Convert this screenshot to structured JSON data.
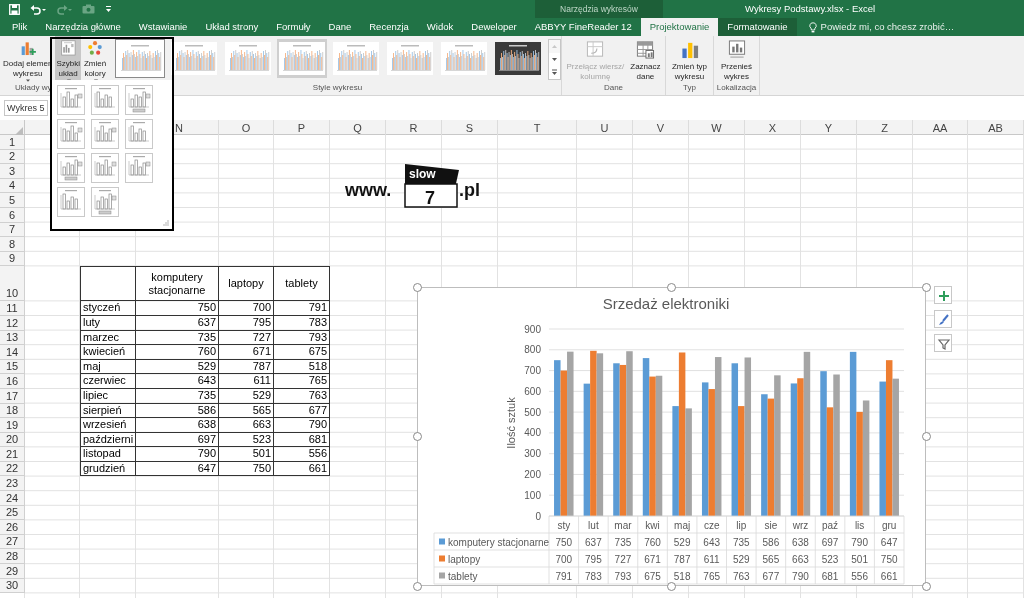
{
  "title_bar": {
    "context_label": "Narzędzia wykresów",
    "title": "Wykresy Podstawy.xlsx - Excel"
  },
  "tabs": [
    {
      "label": "Plik",
      "selected": false,
      "contextual": false
    },
    {
      "label": "Narzędzia główne",
      "selected": false,
      "contextual": false
    },
    {
      "label": "Wstawianie",
      "selected": false,
      "contextual": false
    },
    {
      "label": "Układ strony",
      "selected": false,
      "contextual": false
    },
    {
      "label": "Formuły",
      "selected": false,
      "contextual": false
    },
    {
      "label": "Dane",
      "selected": false,
      "contextual": false
    },
    {
      "label": "Recenzja",
      "selected": false,
      "contextual": false
    },
    {
      "label": "Widok",
      "selected": false,
      "contextual": false
    },
    {
      "label": "Deweloper",
      "selected": false,
      "contextual": false
    },
    {
      "label": "ABBYY FineReader 12",
      "selected": false,
      "contextual": false
    },
    {
      "label": "Projektowanie",
      "selected": true,
      "contextual": true
    },
    {
      "label": "Formatowanie",
      "selected": false,
      "contextual": true
    }
  ],
  "tell_me": "Powiedz mi, co chcesz zrobić…",
  "ribbon": {
    "groups": [
      {
        "label": "Układy wy",
        "buttons": [
          {
            "lines": [
              "Dodaj elemen",
              "wykresu"
            ],
            "dropdown": true,
            "disabled": false,
            "selected": false
          },
          {
            "lines": [
              "Szybki",
              "układ"
            ],
            "dropdown": true,
            "disabled": false,
            "selected": true
          },
          {
            "lines": [
              "Zmień",
              "kolory"
            ],
            "dropdown": true,
            "disabled": false,
            "selected": false
          }
        ]
      },
      {
        "label": "Style wykresu",
        "styles": [
          {
            "selected": true,
            "hovered": false,
            "kind": "light"
          },
          {
            "selected": false,
            "hovered": false,
            "kind": "light"
          },
          {
            "selected": false,
            "hovered": false,
            "kind": "light"
          },
          {
            "selected": false,
            "hovered": true,
            "kind": "light"
          },
          {
            "selected": false,
            "hovered": false,
            "kind": "light"
          },
          {
            "selected": false,
            "hovered": false,
            "kind": "light"
          },
          {
            "selected": false,
            "hovered": false,
            "kind": "light"
          },
          {
            "selected": false,
            "hovered": false,
            "kind": "dark"
          }
        ]
      },
      {
        "label": "Dane",
        "buttons": [
          {
            "lines": [
              "Przełącz wiersz/",
              "kolumnę"
            ],
            "dropdown": false,
            "disabled": true,
            "selected": false
          },
          {
            "lines": [
              "Zaznacz",
              "dane"
            ],
            "dropdown": false,
            "disabled": false,
            "selected": false
          }
        ]
      },
      {
        "label": "Typ",
        "buttons": [
          {
            "lines": [
              "Zmień typ",
              "wykresu"
            ],
            "dropdown": false,
            "disabled": false,
            "selected": false
          }
        ]
      },
      {
        "label": "Lokalizacja",
        "buttons": [
          {
            "lines": [
              "Przenieś",
              "wykres"
            ],
            "dropdown": false,
            "disabled": false,
            "selected": false
          }
        ]
      }
    ]
  },
  "name_box": "Wykres 5",
  "sheet": {
    "columns": [
      "N",
      "O",
      "P",
      "Q",
      "R",
      "S",
      "T",
      "U",
      "V",
      "W",
      "X",
      "Y",
      "Z",
      "AA",
      "AB"
    ],
    "row_numbers": [
      "1",
      "2",
      "3",
      "4",
      "5",
      "6",
      "7",
      "8",
      "9",
      "10",
      "11",
      "12",
      "13",
      "14",
      "15",
      "16",
      "17",
      "18",
      "19",
      "20",
      "21",
      "22",
      "23",
      "24",
      "25",
      "26",
      "27",
      "28",
      "29",
      "30"
    ],
    "table": {
      "columns": [
        "komputery stacjonarne",
        "laptopy",
        "tablety"
      ],
      "rows": [
        {
          "label": "styczeń",
          "values": [
            "750",
            "700",
            "791"
          ]
        },
        {
          "label": "luty",
          "values": [
            "637",
            "795",
            "783"
          ]
        },
        {
          "label": "marzec",
          "values": [
            "735",
            "727",
            "793"
          ]
        },
        {
          "label": "kwiecień",
          "values": [
            "760",
            "671",
            "675"
          ]
        },
        {
          "label": "maj",
          "values": [
            "529",
            "787",
            "518"
          ]
        },
        {
          "label": "czerwiec",
          "values": [
            "643",
            "611",
            "765"
          ]
        },
        {
          "label": "lipiec",
          "values": [
            "735",
            "529",
            "763"
          ]
        },
        {
          "label": "sierpień",
          "values": [
            "586",
            "565",
            "677"
          ]
        },
        {
          "label": "wrzesień",
          "values": [
            "638",
            "663",
            "790"
          ]
        },
        {
          "label": "październi",
          "values": [
            "697",
            "523",
            "681"
          ]
        },
        {
          "label": "listopad",
          "values": [
            "790",
            "501",
            "556"
          ]
        },
        {
          "label": "grudzień",
          "values": [
            "647",
            "750",
            "661"
          ]
        }
      ]
    }
  },
  "logo": {
    "prefix": "www.",
    "flag": "slow",
    "number": "7",
    "suffix": ".pl"
  },
  "chart": {
    "data_table": {
      "rows": [
        {
          "values": [
            "750",
            "637",
            "735",
            "760",
            "529",
            "643",
            "735",
            "586",
            "638",
            "697",
            "790",
            "647"
          ]
        },
        {
          "values": [
            "700",
            "795",
            "727",
            "671",
            "787",
            "611",
            "529",
            "565",
            "663",
            "523",
            "501",
            "750"
          ]
        },
        {
          "values": [
            "791",
            "783",
            "793",
            "675",
            "518",
            "765",
            "763",
            "677",
            "790",
            "681",
            "556",
            "661"
          ]
        }
      ]
    },
    "chart_data": {
      "type": "bar",
      "grid": true,
      "legend": true,
      "title": "Srzedaż elektroniki",
      "ylabel": "Ilość sztuk",
      "categories": [
        "sty",
        "lut",
        "mar",
        "kwi",
        "maj",
        "cze",
        "lip",
        "sie",
        "wrz",
        "paź",
        "lis",
        "gru"
      ],
      "series": [
        {
          "name": "komputery stacjonarne",
          "color": "#5b9bd5",
          "values": [
            750,
            637,
            735,
            760,
            529,
            643,
            735,
            586,
            638,
            697,
            790,
            647
          ]
        },
        {
          "name": "laptopy",
          "color": "#ed7d31",
          "values": [
            700,
            795,
            727,
            671,
            787,
            611,
            529,
            565,
            663,
            523,
            501,
            750
          ]
        },
        {
          "name": "tablety",
          "color": "#a5a5a5",
          "values": [
            791,
            783,
            793,
            675,
            518,
            765,
            763,
            677,
            790,
            681,
            556,
            661
          ]
        }
      ],
      "ylim": [
        0,
        900
      ],
      "yticks": [
        0,
        100,
        200,
        300,
        400,
        500,
        600,
        700,
        800,
        900
      ]
    }
  }
}
